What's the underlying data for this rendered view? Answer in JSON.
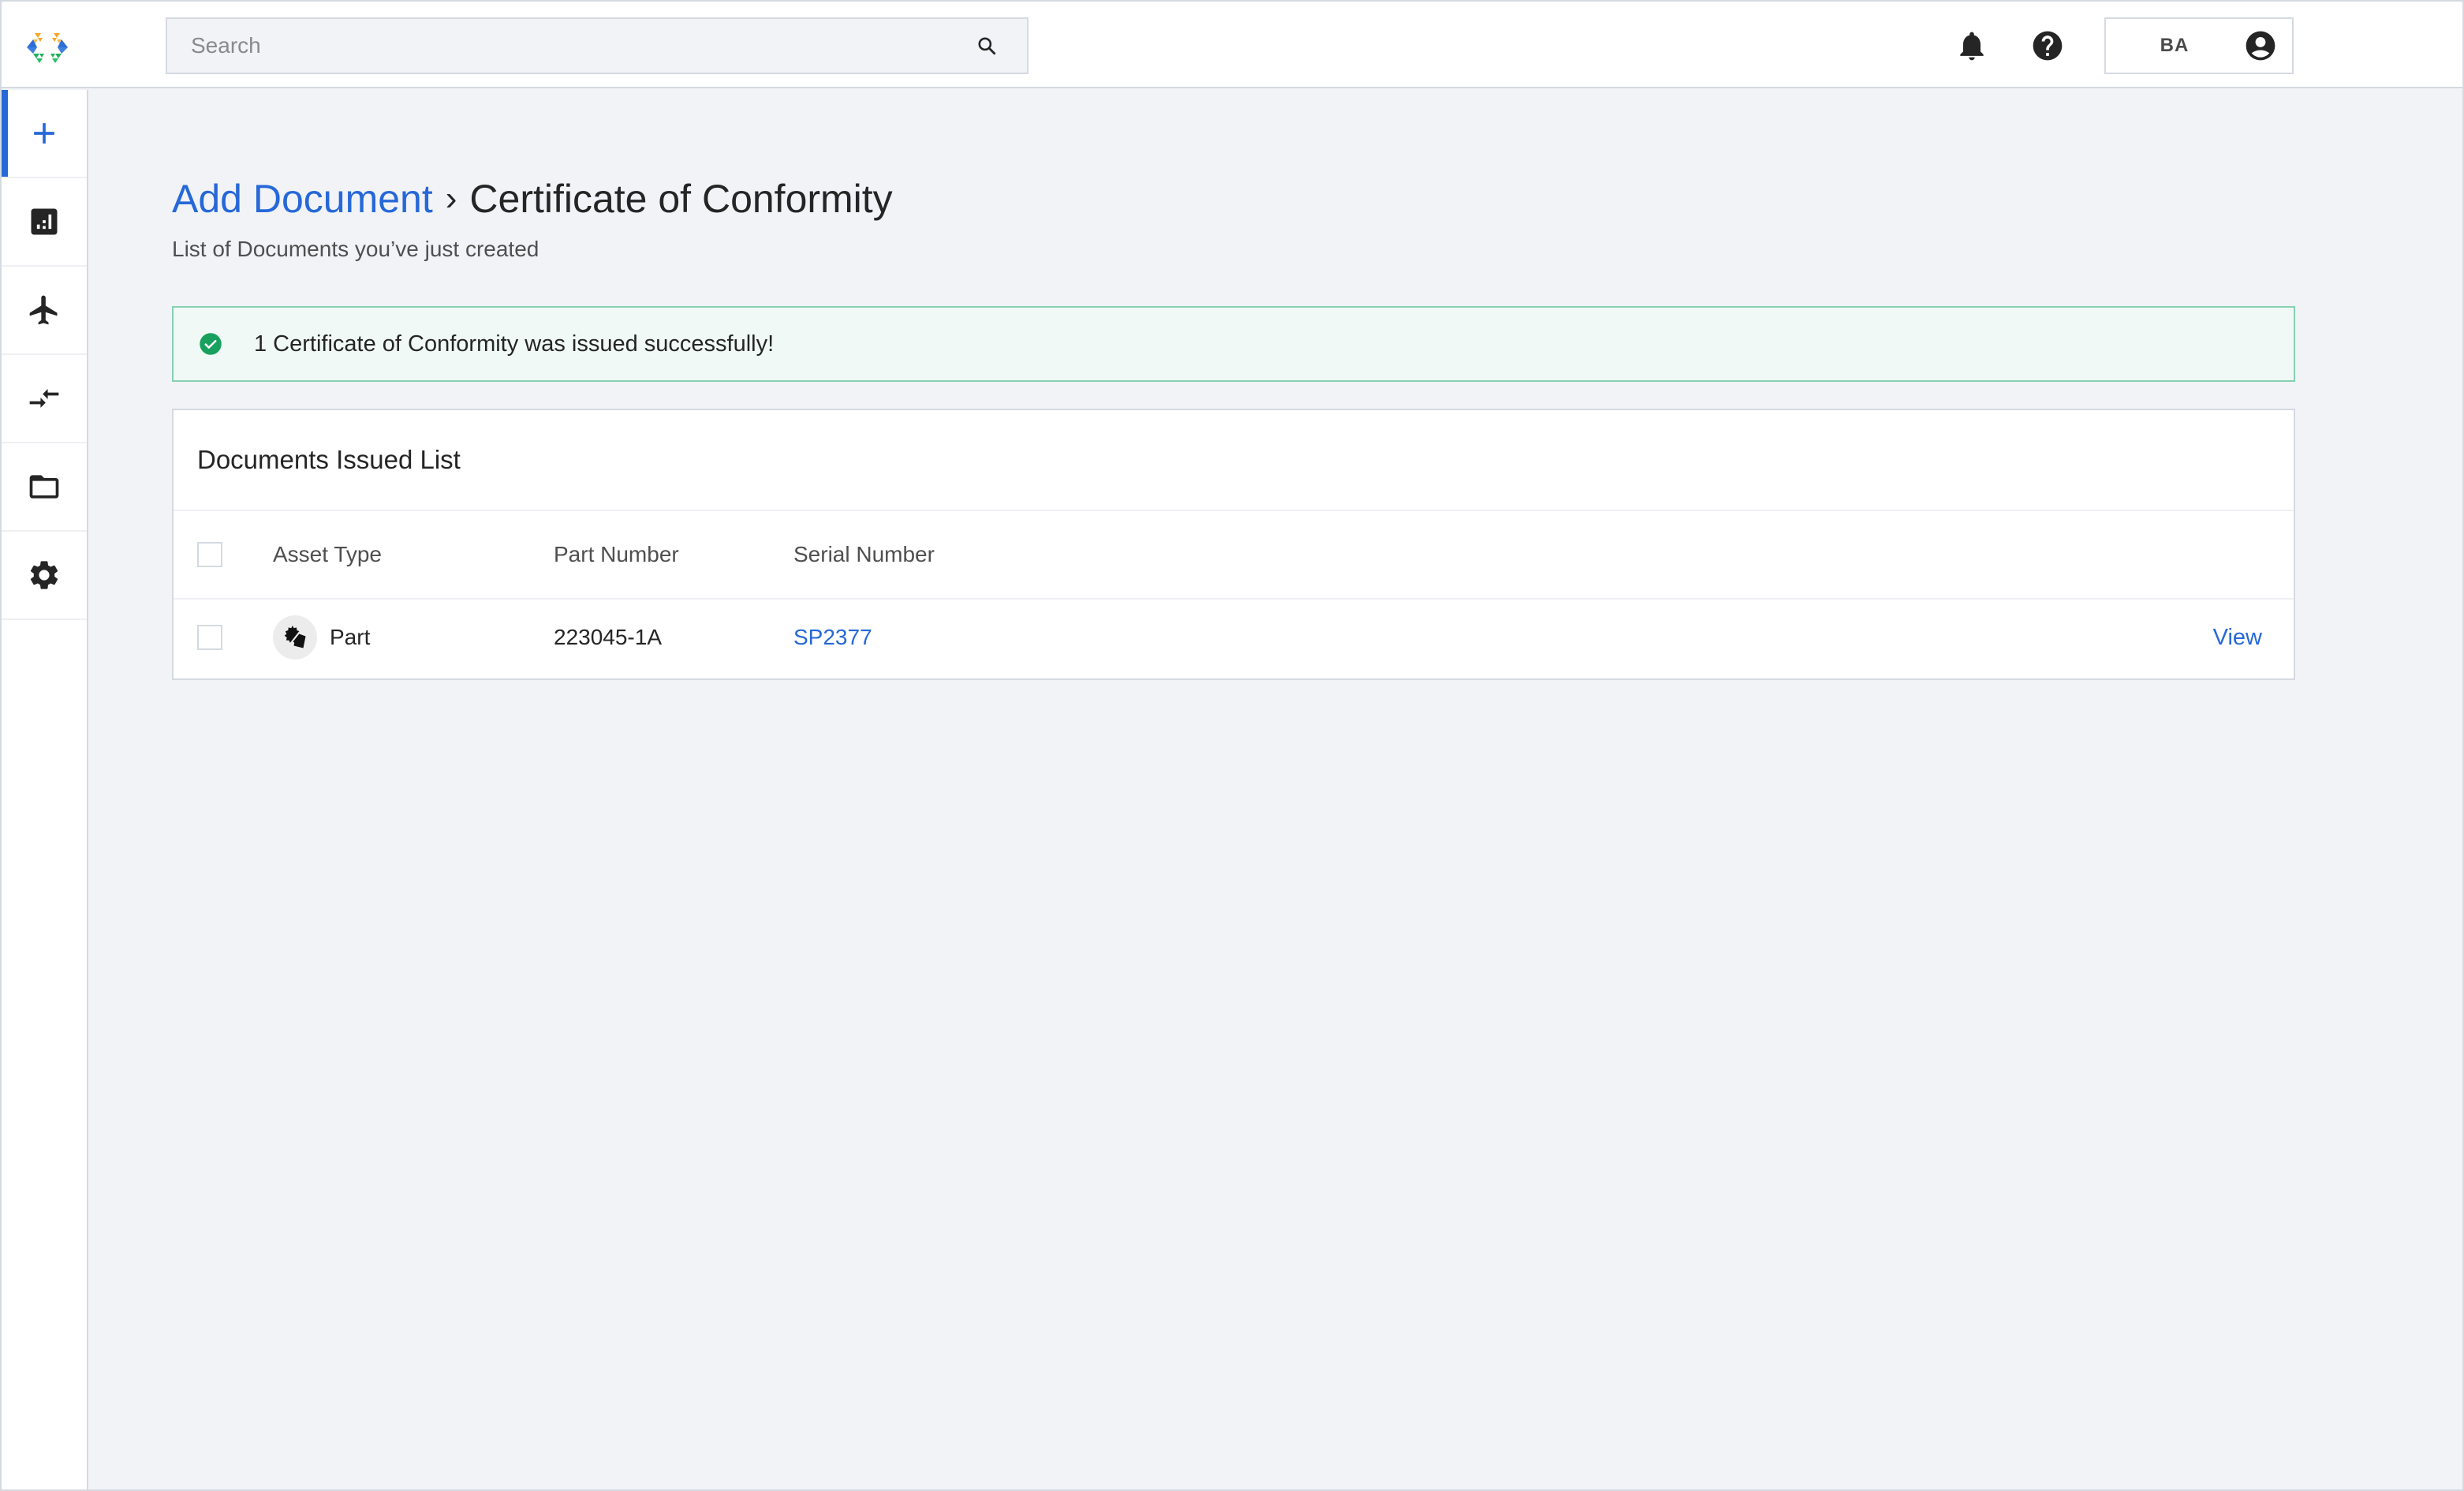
{
  "topbar": {
    "search": {
      "placeholder": "Search",
      "value": ""
    },
    "user": {
      "initials": "BA"
    },
    "icons": {
      "logo": "hexagon-logo",
      "search": "search-icon",
      "notifications": "bell-icon",
      "help": "help-icon",
      "account": "account-circle-icon"
    }
  },
  "sidebar": {
    "items": [
      {
        "name": "add",
        "icon": "plus-icon",
        "active": true
      },
      {
        "name": "reports",
        "icon": "bar-chart-icon",
        "active": false
      },
      {
        "name": "aircraft",
        "icon": "airplane-icon",
        "active": false
      },
      {
        "name": "transfers",
        "icon": "swap-arrows-icon",
        "active": false
      },
      {
        "name": "documents",
        "icon": "folder-icon",
        "active": false
      },
      {
        "name": "settings",
        "icon": "gear-icon",
        "active": false
      }
    ]
  },
  "page": {
    "breadcrumb": {
      "parent": "Add Document",
      "separator": "›",
      "current": "Certificate of Conformity"
    },
    "subtitle": "List of Documents you’ve just created",
    "alert": {
      "type": "success",
      "message": "1 Certificate of Conformity was issued successfully!"
    },
    "documents": {
      "title": "Documents Issued List",
      "columns": [
        "Asset Type",
        "Part Number",
        "Serial Number"
      ],
      "rows": [
        {
          "asset_type": "Part",
          "asset_icon": "part-gear-icon",
          "part_number": "223045-1A",
          "serial_number": "SP2377",
          "action": "View",
          "checked": false
        }
      ],
      "select_all_checked": false
    }
  },
  "colors": {
    "accent": "#2668d8",
    "success": "#18a05e",
    "success_bg": "#f0f9f5",
    "success_border": "#86d1b2",
    "background": "#f1f3f7",
    "border": "#d5dae1",
    "icon": "#252525"
  }
}
